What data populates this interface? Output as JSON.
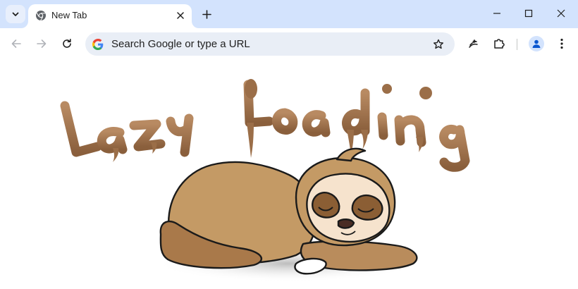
{
  "tab": {
    "title": "New Tab"
  },
  "omnibox": {
    "placeholder": "Search Google or type a URL"
  },
  "hero": {
    "text": "Lazy Loading",
    "image": "sleeping-sloth"
  },
  "icons": {
    "tab_search": "chevron-down-icon",
    "favicon": "chrome-icon",
    "tab_close": "close-icon",
    "new_tab": "plus-icon",
    "minimize": "minimize-icon",
    "maximize": "maximize-icon",
    "window_close": "close-icon",
    "back": "arrow-left-icon",
    "forward": "arrow-right-icon",
    "reload": "reload-icon",
    "google": "google-g-icon",
    "bookmark": "star-icon",
    "ai": "sparkle-icon",
    "extensions": "puzzle-icon",
    "profile": "person-icon",
    "menu": "more-vert-icon"
  },
  "colors": {
    "tabstrip_bg": "#d3e3fd",
    "omnibox_bg": "#e9eef6",
    "sloth_fur": "#c49a65",
    "sloth_dark": "#8b5e34",
    "sloth_face": "#f6e3cd",
    "lettering": "#9b6e48"
  }
}
